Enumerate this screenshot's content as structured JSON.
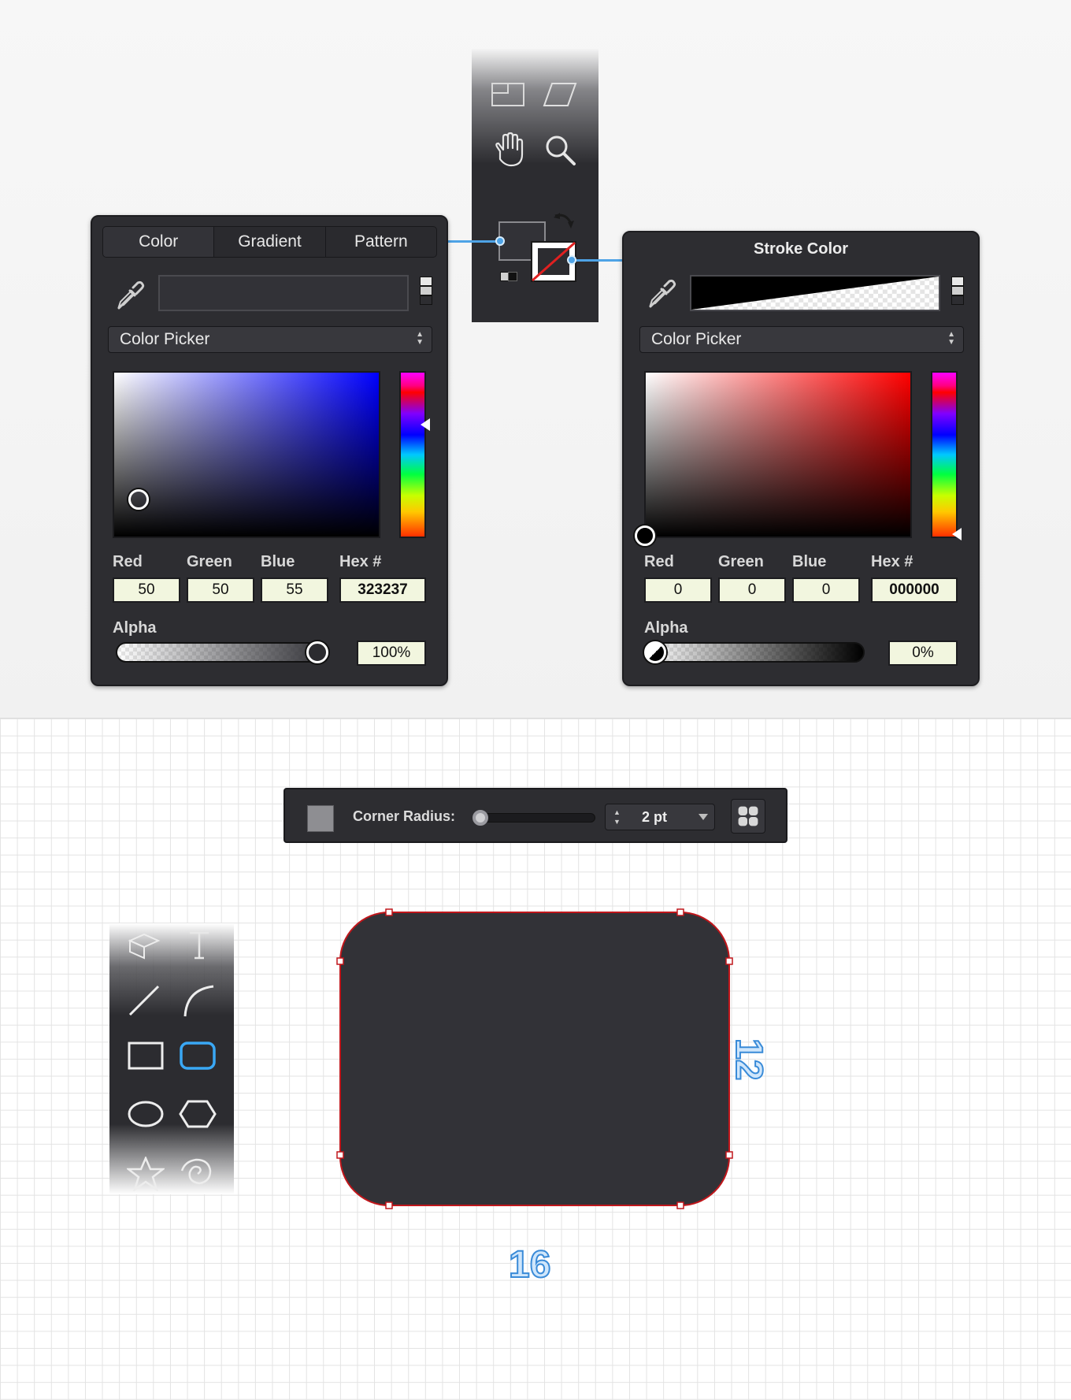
{
  "fill_panel": {
    "tabs": [
      {
        "label": "Color",
        "active": true
      },
      {
        "label": "Gradient",
        "active": false
      },
      {
        "label": "Pattern",
        "active": false
      }
    ],
    "picker_mode": "Color Picker",
    "base_hue": "#0000ff",
    "channel_labels": {
      "red": "Red",
      "green": "Green",
      "blue": "Blue",
      "hex": "Hex #"
    },
    "values": {
      "red": "50",
      "green": "50",
      "blue": "55",
      "hex": "323237"
    },
    "alpha_label": "Alpha",
    "alpha_value": "100%",
    "alpha_fraction": 1.0,
    "color": "#323237"
  },
  "stroke_panel": {
    "title": "Stroke Color",
    "picker_mode": "Color Picker",
    "base_hue": "#ff0000",
    "channel_labels": {
      "red": "Red",
      "green": "Green",
      "blue": "Blue",
      "hex": "Hex #"
    },
    "values": {
      "red": "0",
      "green": "0",
      "blue": "0",
      "hex": "000000"
    },
    "alpha_label": "Alpha",
    "alpha_value": "0%",
    "alpha_fraction": 0.0
  },
  "top_tools": [
    "artboard-icon",
    "skew-icon",
    "hand-icon",
    "zoom-icon",
    "fill-swatch-icon",
    "stroke-swatch-icon",
    "swap-colors-icon",
    "default-colors-icon"
  ],
  "corner_bar": {
    "label": "Corner Radius:",
    "value": "2 pt",
    "swatch_color": "#8e8e92"
  },
  "shape_tools": [
    "3d-box-icon",
    "text-icon",
    "line-icon",
    "arc-icon",
    "rectangle-icon",
    "rounded-rectangle-icon",
    "ellipse-icon",
    "polygon-icon",
    "star-icon",
    "spiral-icon"
  ],
  "canvas": {
    "shape_fill": "#323237",
    "shape_stroke": "#c0161b",
    "width_label": "16",
    "height_label": "12",
    "accent": "#3a8bd8"
  }
}
